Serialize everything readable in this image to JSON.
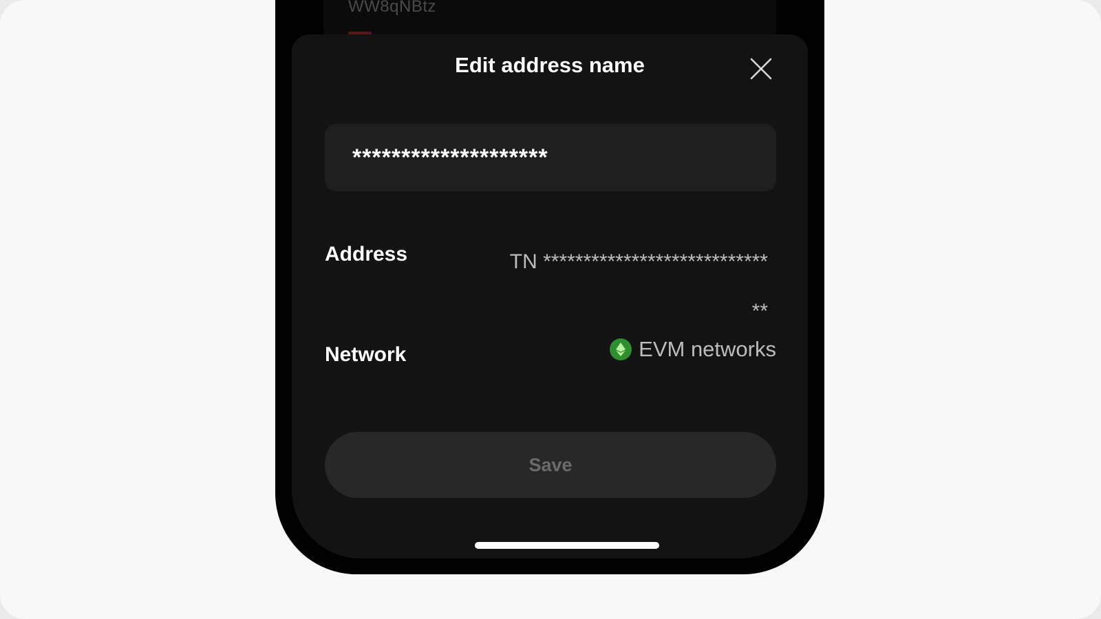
{
  "background": {
    "address_fragment": "WW8qNBtz"
  },
  "dialog": {
    "title": "Edit address name",
    "close_icon": "close-icon",
    "name_input": {
      "value": "********************"
    },
    "address": {
      "label": "Address",
      "value": "TN ******************************"
    },
    "network": {
      "label": "Network",
      "icon": "ethereum-icon",
      "value": "EVM networks"
    },
    "save_label": "Save"
  },
  "colors": {
    "sheet_background": "#131313",
    "input_background": "#1e1e1e",
    "button_background": "#282828",
    "network_icon": "#2f8f2f"
  }
}
